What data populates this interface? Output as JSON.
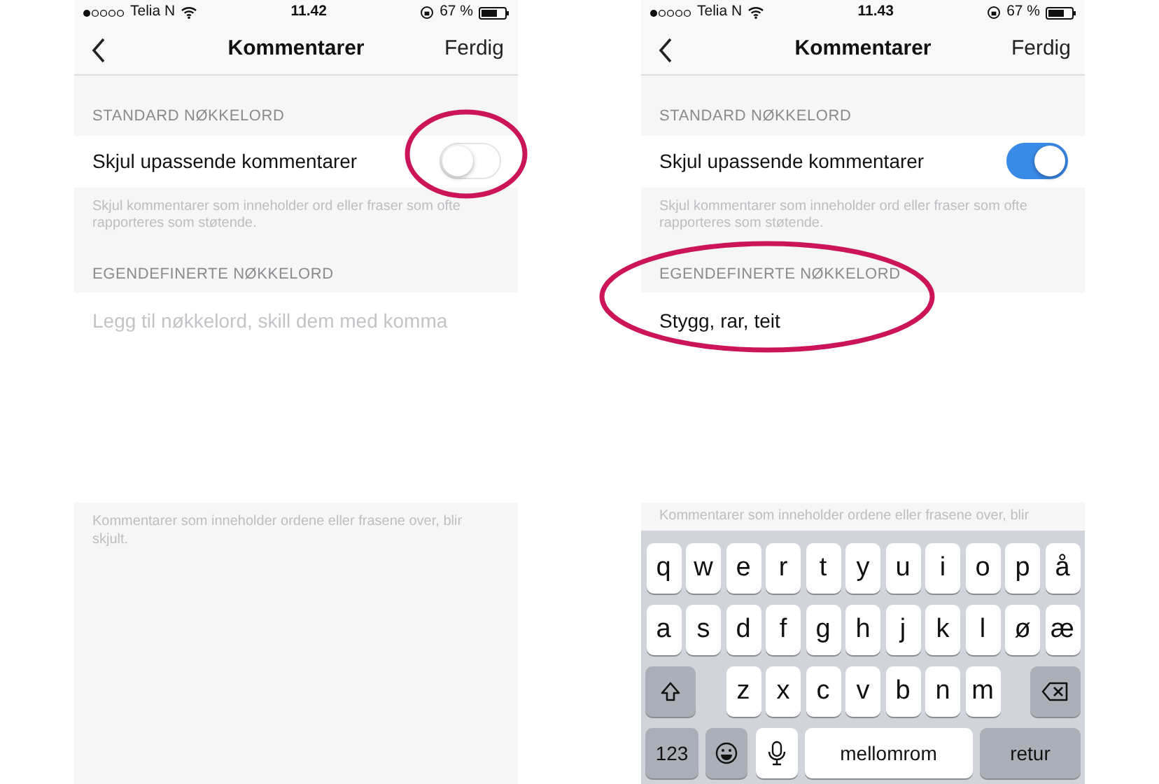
{
  "screens": [
    {
      "status_bar": {
        "carrier": "Telia N",
        "time": "11.42",
        "battery": "67 %"
      },
      "nav": {
        "title": "Kommentarer",
        "done": "Ferdig"
      },
      "standard_header": "STANDARD NØKKELORD",
      "toggle": {
        "label": "Skjul upassende kommentarer",
        "on": false,
        "circled": true
      },
      "toggle_note": "Skjul kommentarer som inneholder ord eller fraser som ofte rapporteres som støtende.",
      "custom_header": "EGENDEFINERTE NØKKELORD",
      "keywords": {
        "placeholder": "Legg til nøkkelord, skill dem med komma",
        "circled": false
      },
      "footer_note": "Kommentarer som inneholder ordene eller frasene over, blir skjult."
    },
    {
      "status_bar": {
        "carrier": "Telia N",
        "time": "11.43",
        "battery": "67 %"
      },
      "nav": {
        "title": "Kommentarer",
        "done": "Ferdig"
      },
      "standard_header": "STANDARD NØKKELORD",
      "toggle": {
        "label": "Skjul upassende kommentarer",
        "on": true,
        "circled": false
      },
      "toggle_note": "Skjul kommentarer som inneholder ord eller fraser som ofte rapporteres som støtende.",
      "custom_header": "EGENDEFINERTE NØKKELORD",
      "keywords": {
        "value": "Stygg, rar, teit",
        "circled": true
      },
      "footer_note": "Kommentarer som inneholder ordene eller frasene over, blir",
      "keyboard": {
        "letter_rows": [
          [
            "q",
            "w",
            "e",
            "r",
            "t",
            "y",
            "u",
            "i",
            "o",
            "p",
            "å"
          ],
          [
            "a",
            "s",
            "d",
            "f",
            "g",
            "h",
            "j",
            "k",
            "l",
            "ø",
            "æ"
          ],
          [
            "z",
            "x",
            "c",
            "v",
            "b",
            "n",
            "m"
          ]
        ],
        "number_key": "123",
        "space_key": "mellomrom",
        "return_key": "retur"
      }
    }
  ]
}
